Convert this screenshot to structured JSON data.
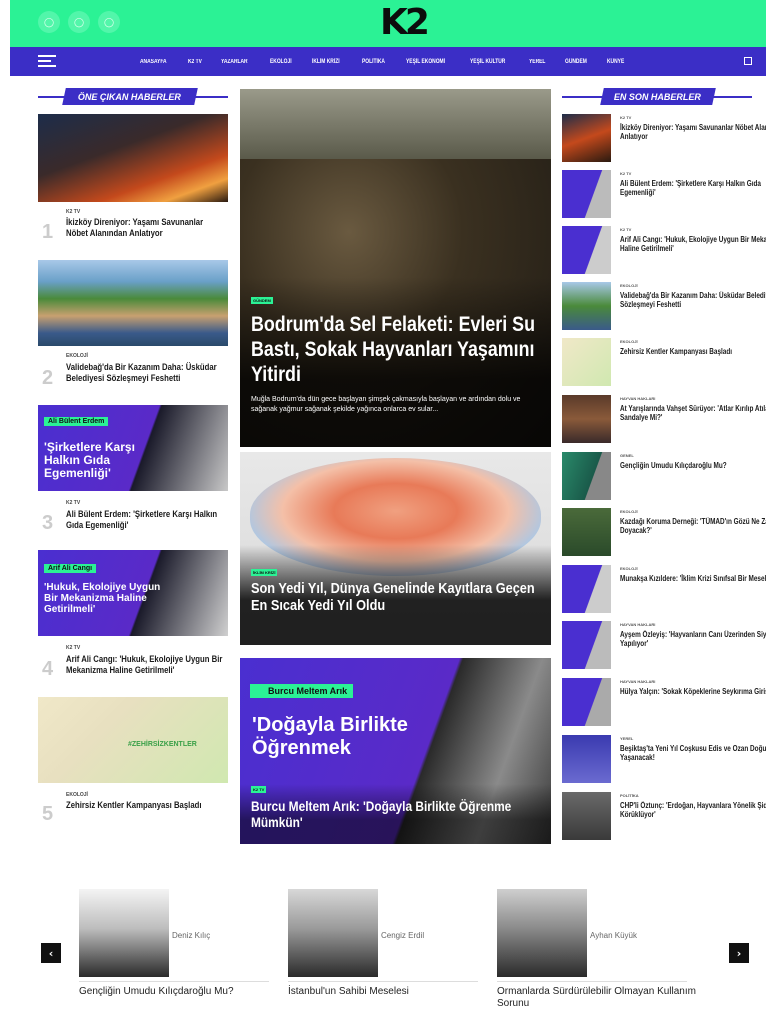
{
  "header": {
    "logo": "K2",
    "social_icons": [
      "circle-icon",
      "circle-icon",
      "circle-icon"
    ]
  },
  "nav": {
    "items": [
      "ANASAYFA",
      "K2 TV",
      "YAZARLAR",
      "EKOLOJİ",
      "İKLİM KRİZİ",
      "POLİTİKA",
      "YEŞİL EKONOMİ",
      "YEŞİL KÜLTÜR",
      "YEREL",
      "GÜNDEM",
      "KÜNYE"
    ]
  },
  "featured": {
    "title": "ÖNE ÇIKAN HABERLER",
    "items": [
      {
        "num": "1",
        "cat": "K2 TV",
        "title": "İkizköy Direniyor: Yaşamı Savunanlar Nöbet Alanından Anlatıyor"
      },
      {
        "num": "2",
        "cat": "EKOLOJİ",
        "title": "Validebağ'da Bir Kazanım Daha: Üsküdar Belediyesi Sözleşmeyi Feshetti"
      },
      {
        "num": "3",
        "cat": "K2 TV",
        "title": "Ali Bülent Erdem: 'Şirketlere Karşı Halkın Gıda Egemenliği'",
        "overlay_name": "Ali Bülent Erdem",
        "overlay_text": "'Şirketlere Karşı Halkın Gıda Egemenliği'"
      },
      {
        "num": "4",
        "cat": "K2 TV",
        "title": "Arif Ali Cangı: 'Hukuk, Ekolojiye Uygun Bir Mekanizma Haline Getirilmeli'",
        "overlay_name": "Arif Ali Cangı",
        "overlay_text": "'Hukuk, Ekolojiye Uygun Bir Mekanizma Haline Getirilmeli'"
      },
      {
        "num": "5",
        "cat": "EKOLOJİ",
        "title": "Zehirsiz Kentler Kampanyası Başladı",
        "overlay_text": "#ZEHİRSİZKENTLER"
      }
    ]
  },
  "hero": {
    "badge": "GÜNDEM",
    "title": "Bodrum'da Sel Felaketi: Evleri Su Bastı, Sokak Hayvanları Yaşamını Yitirdi",
    "desc": "Muğla Bodrum'da dün gece başlayan şimşek çakmasıyla başlayan ve ardından dolu ve sağanak yağmur sağanak şekilde yağınca onlarca ev sular..."
  },
  "mid": {
    "badge": "İKLİM KRİZİ",
    "title": "Son Yedi Yıl, Dünya Genelinde Kayıtlara Geçen En Sıcak Yedi Yıl Oldu"
  },
  "bottom": {
    "badge": "K2 TV",
    "overlay_name": "Burcu Meltem Arık",
    "overlay_text": "'Doğayla Birlikte Öğrenmek",
    "title": "Burcu Meltem Arık: 'Doğayla Birlikte Öğrenme Mümkün'"
  },
  "latest": {
    "title": "EN SON HABERLER",
    "items": [
      {
        "cat": "K2 TV",
        "title": "İkizköy Direniyor: Yaşamı Savunanlar Nöbet Alanından Anlatıyor"
      },
      {
        "cat": "K2 TV",
        "title": "Ali Bülent Erdem: 'Şirketlere Karşı Halkın Gıda Egemenliği'"
      },
      {
        "cat": "K2 TV",
        "title": "Arif Ali Cangı: 'Hukuk, Ekolojiye Uygun Bir Mekanizma Haline Getirilmeli'"
      },
      {
        "cat": "EKOLOJİ",
        "title": "Validebağ'da Bir Kazanım Daha: Üsküdar Belediyesi Sözleşmeyi Feshetti"
      },
      {
        "cat": "EKOLOJİ",
        "title": "Zehirsiz Kentler Kampanyası Başladı"
      },
      {
        "cat": "HAYVAN HAKLARI",
        "title": "At Yarışlarında Vahşet Sürüyor: 'Atlar Kırılıp Atılacak Sandalye Mi?'"
      },
      {
        "cat": "GENEL",
        "title": "Gençliğin Umudu Kılıçdaroğlu Mu?"
      },
      {
        "cat": "EKOLOJİ",
        "title": "Kazdağı Koruma Derneği: 'TÜMAD'ın Gözü Ne Zaman Doyacak?'"
      },
      {
        "cat": "EKOLOJİ",
        "title": "Munakşa Kızıldere: 'İklim Krizi Sınıfsal Bir Meseledir'"
      },
      {
        "cat": "HAYVAN HAKLARI",
        "title": "Ayşem Özleyiş: 'Hayvanların Canı Üzerinden Siyaset Yapılıyor'"
      },
      {
        "cat": "HAYVAN HAKLARI",
        "title": "Hülya Yalçın: 'Sokak Köpeklerine Seykırıma Girişildi'"
      },
      {
        "cat": "YEREL",
        "title": "Beşiktaş'ta Yeni Yıl Coşkusu Edis ve Ozan Doğulu İle Yaşanacak!"
      },
      {
        "cat": "POLİTİKA",
        "title": "CHP'li Öztunç: 'Erdoğan, Hayvanlara Yönelik Şiddeti Körüklüyor'"
      }
    ]
  },
  "authors": {
    "prev": "‹",
    "next": "›",
    "items": [
      {
        "name": "Deniz Kılıç",
        "title": "Gençliğin Umudu Kılıçdaroğlu Mu?"
      },
      {
        "name": "Cengiz Erdil",
        "title": "İstanbul'un Sahibi Meselesi"
      },
      {
        "name": "Ayhan Küyük",
        "title": "Ormanlarda Sürdürülebilir Olmayan Kullanım Sorunu"
      }
    ]
  },
  "colors": {
    "brand_green": "#2bf295",
    "brand_purple": "#3b2ec6"
  }
}
